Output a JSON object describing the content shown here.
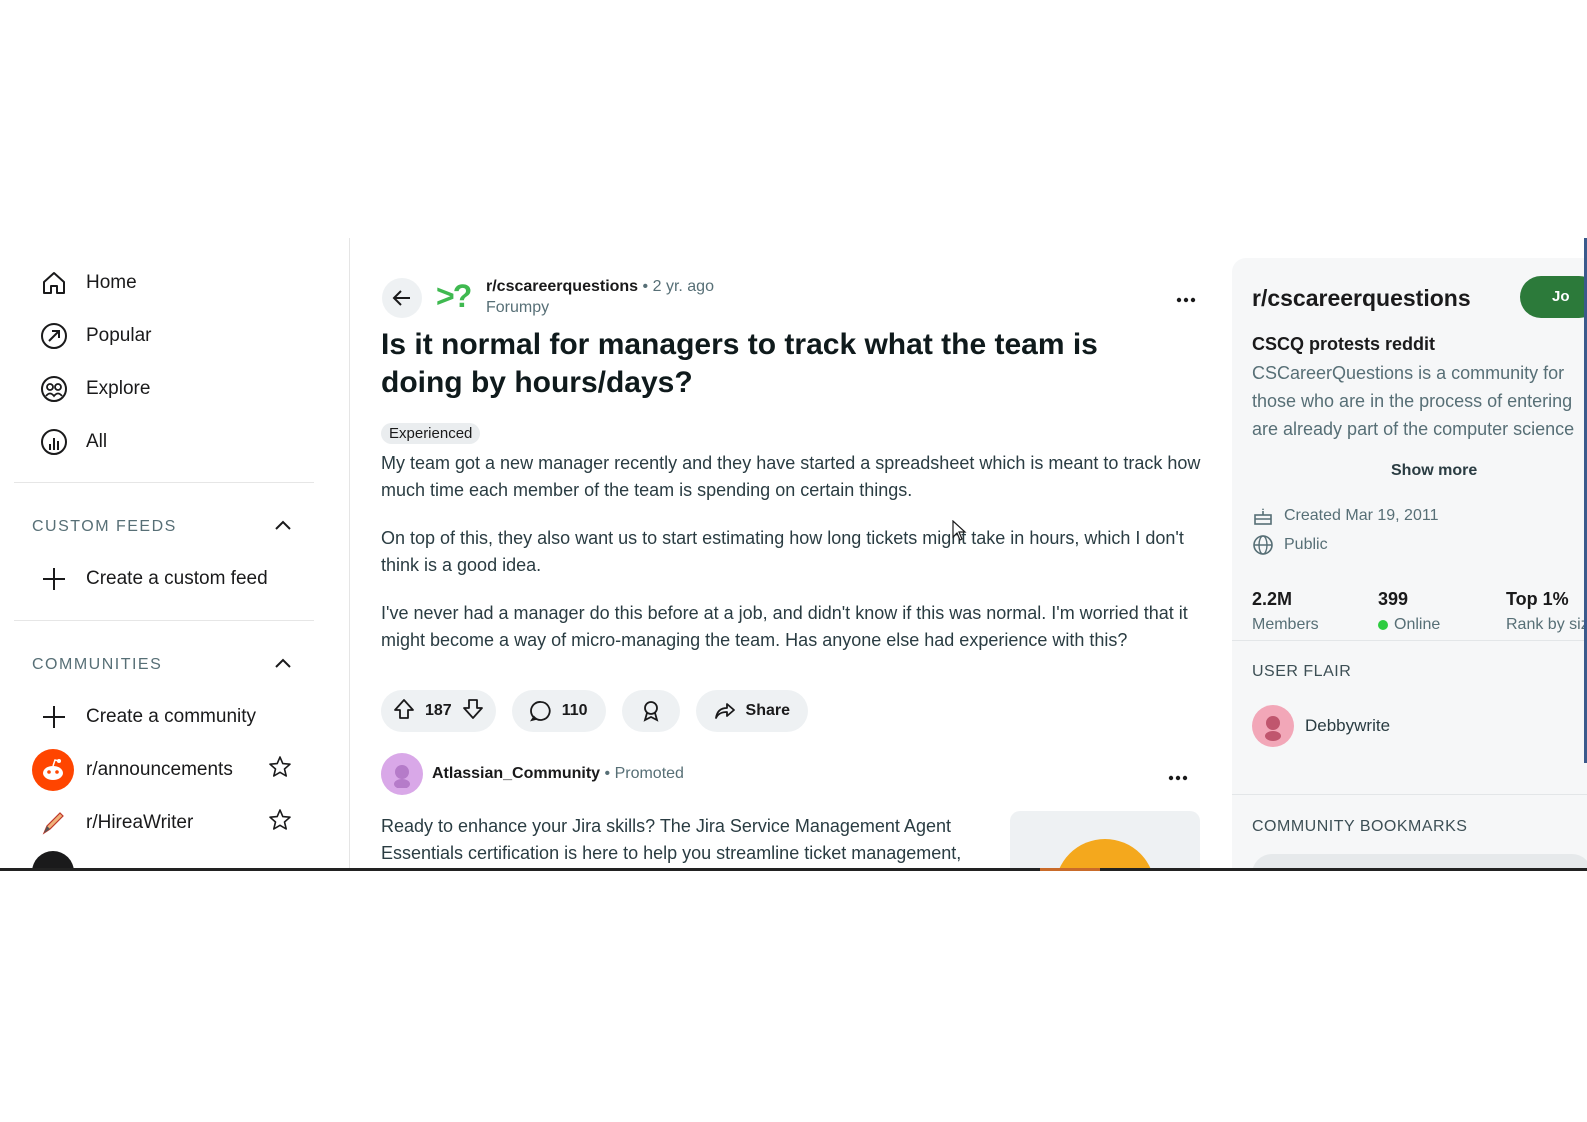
{
  "sidebar": {
    "nav": [
      {
        "label": "Home",
        "icon": "home-icon"
      },
      {
        "label": "Popular",
        "icon": "popular-icon"
      },
      {
        "label": "Explore",
        "icon": "explore-icon"
      },
      {
        "label": "All",
        "icon": "all-icon"
      }
    ],
    "custom_feeds": {
      "heading": "CUSTOM FEEDS",
      "create_label": "Create a custom feed"
    },
    "communities": {
      "heading": "COMMUNITIES",
      "create_label": "Create a community",
      "items": [
        {
          "label": "r/announcements"
        },
        {
          "label": "r/HireaWriter"
        }
      ]
    }
  },
  "post": {
    "subreddit": "r/cscareerquestions",
    "separator": "•",
    "age": "2 yr. ago",
    "author": "Forumpy",
    "logo_text": ">?",
    "title": "Is it normal for managers to track what the team is doing by hours/days?",
    "flair": "Experienced",
    "paragraphs": [
      "My team got a new manager recently and they have started a spreadsheet which is meant to track how much time each member of the team is spending on certain things.",
      "On top of this, they also want us to start estimating how long tickets might take in hours, which I don't think is a good idea.",
      "I've never had a manager do this before at a job, and didn't know if this was normal. I'm worried that it might become a way of micro-managing the team. Has anyone else had experience with this?"
    ],
    "upvotes": "187",
    "comments": "110",
    "share_label": "Share"
  },
  "promoted": {
    "name": "Atlassian_Community",
    "separator": "•",
    "tag": "Promoted",
    "text": "Ready to enhance your Jira skills? The Jira Service Management Agent Essentials certification is here to help you streamline ticket management,"
  },
  "community_panel": {
    "name": "r/cscareerquestions",
    "join_label": "Jo",
    "subtitle": "CSCQ protests reddit",
    "description_lines": [
      "CSCareerQuestions is a community for",
      "those who are in the process of entering",
      "are already part of the computer science"
    ],
    "show_more": "Show more",
    "created": "Created Mar 19, 2011",
    "visibility": "Public",
    "stats": [
      {
        "value": "2.2M",
        "label": "Members"
      },
      {
        "value": "399",
        "label": "Online"
      },
      {
        "value": "Top 1%",
        "label": "Rank by size"
      }
    ],
    "user_flair_heading": "USER FLAIR",
    "user_flair_name": "Debbywrite",
    "bookmarks_heading": "COMMUNITY BOOKMARKS"
  },
  "colors": {
    "accent_green": "#2c7a3a",
    "logo_green": "#3fb950",
    "reddit_orange": "#ff4500"
  }
}
